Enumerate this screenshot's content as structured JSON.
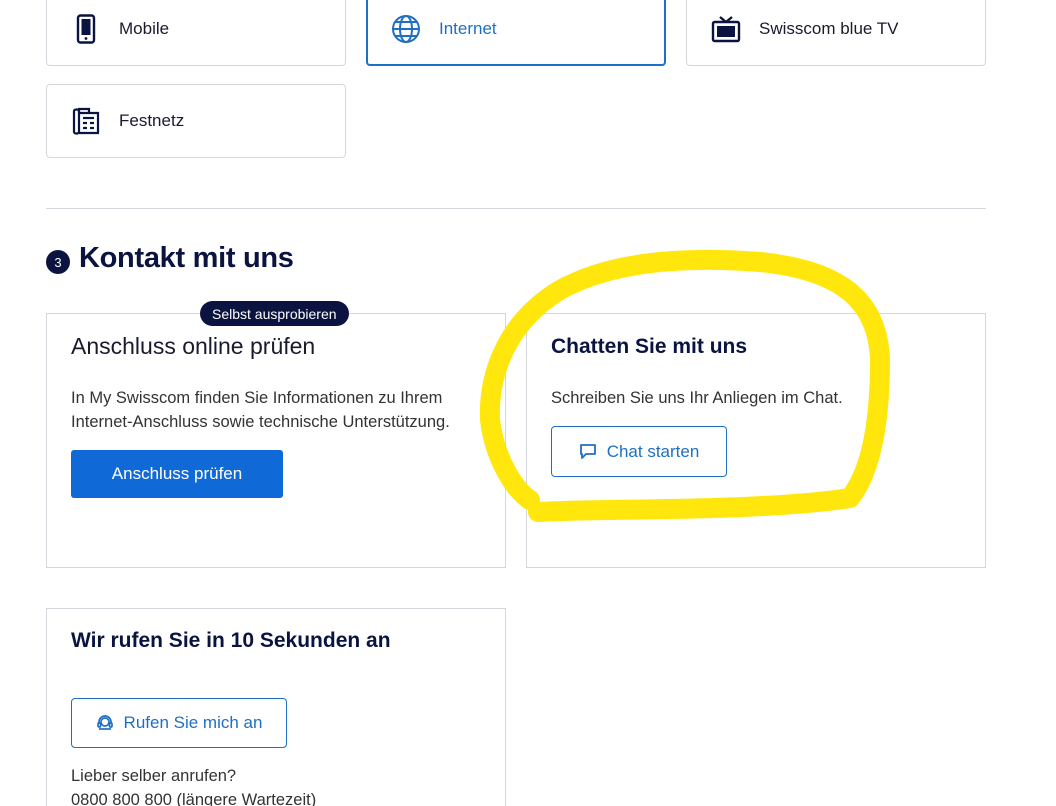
{
  "products": [
    {
      "label": "Mobile",
      "icon": "mobile-phone-icon",
      "selected": false
    },
    {
      "label": "Internet",
      "icon": "globe-icon",
      "selected": true
    },
    {
      "label": "Swisscom blue TV",
      "icon": "tv-icon",
      "selected": false
    },
    {
      "label": "Festnetz",
      "icon": "landline-phone-icon",
      "selected": false
    }
  ],
  "contact": {
    "step": "3",
    "title": "Kontakt mit uns",
    "online_check": {
      "badge": "Selbst ausprobieren",
      "title": "Anschluss online prüfen",
      "text_line1": "In My Swisscom finden Sie Informationen zu Ihrem",
      "text_line2": "Internet-Anschluss sowie technische Unterstützung.",
      "button": "Anschluss prüfen"
    },
    "chat": {
      "title": "Chatten Sie mit uns",
      "text": "Schreiben Sie uns Ihr Anliegen im Chat.",
      "button": "Chat starten",
      "button_icon": "chat-bubble-icon"
    },
    "callback": {
      "title": "Wir rufen Sie in 10 Sekunden an",
      "button": "Rufen Sie mich an",
      "button_icon": "headset-icon",
      "self_call_label": "Lieber selber anrufen?",
      "phone": "0800 800 800 (längere Wartezeit)"
    }
  },
  "colors": {
    "brand_dark": "#0b1340",
    "primary_blue": "#0f6ad8",
    "link_blue": "#1f6fc2",
    "highlight_yellow": "#ffe600"
  }
}
